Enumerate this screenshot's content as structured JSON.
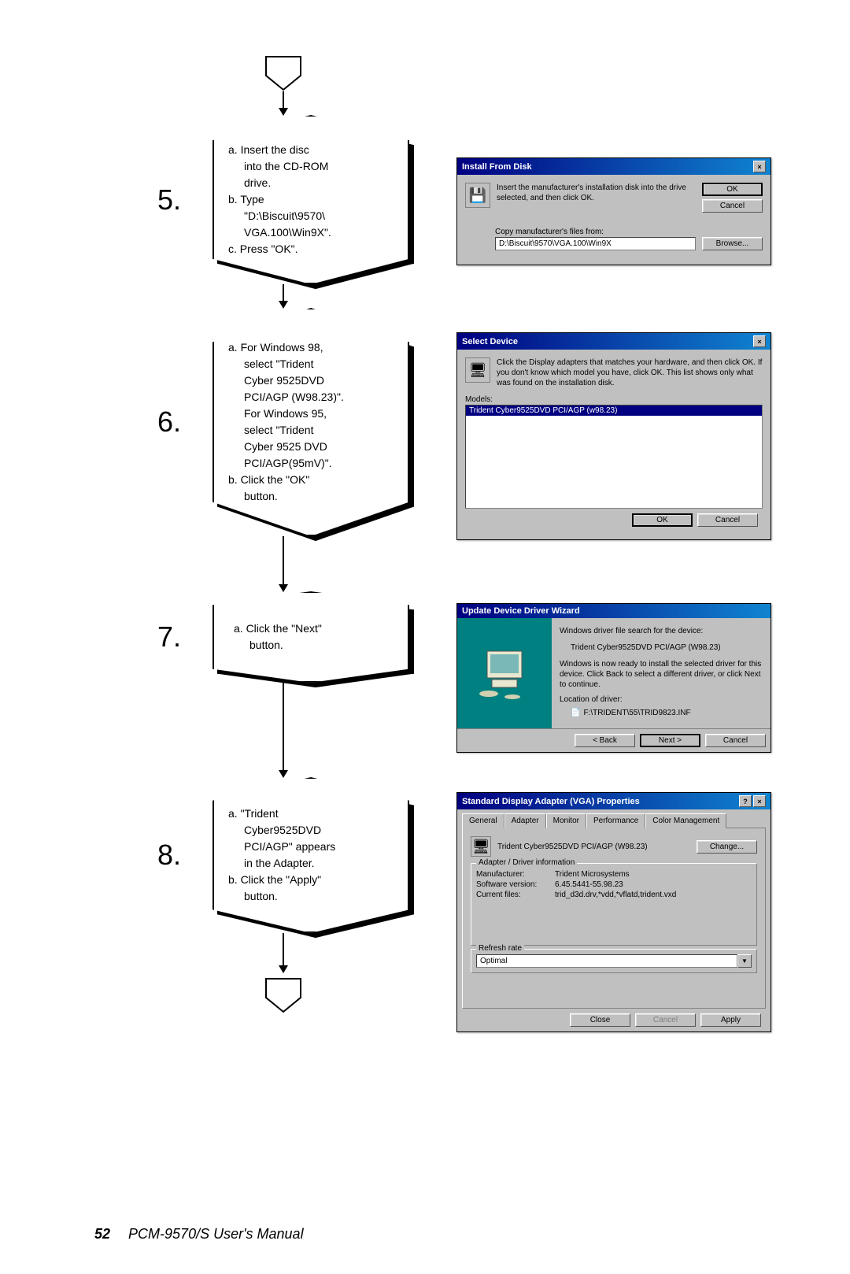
{
  "footer": {
    "page": "52",
    "title": "PCM-9570/S  User's Manual"
  },
  "steps": [
    {
      "num": "5.",
      "lines": [
        "a. Insert the disc",
        "   into the CD-ROM",
        "   drive.",
        "b. Type",
        "   \"D:\\Biscuit\\9570\\",
        "   VGA.100\\Win9X\".",
        "c. Press \"OK\"."
      ]
    },
    {
      "num": "6.",
      "lines": [
        "a. For Windows 98,",
        "   select \"Trident",
        "   Cyber 9525DVD",
        "   PCI/AGP (W98.23)\".",
        "   For Windows 95,",
        "   select \"Trident",
        "   Cyber 9525 DVD",
        "   PCI/AGP(95mV)\".",
        "b. Click the \"OK\"",
        "   button."
      ]
    },
    {
      "num": "7.",
      "lines": [
        "a. Click the \"Next\"",
        "   button."
      ]
    },
    {
      "num": "8.",
      "lines": [
        "a. \"Trident",
        "   Cyber9525DVD",
        "   PCI/AGP\" appears",
        "   in the Adapter.",
        "b. Click the \"Apply\"",
        "   button."
      ]
    }
  ],
  "dlg1": {
    "title": "Install From Disk",
    "msg": "Insert the manufacturer's installation disk into the drive selected, and then click OK.",
    "copylabel": "Copy manufacturer's files from:",
    "path": "D:\\Biscuit\\9570\\VGA.100\\Win9X",
    "ok": "OK",
    "cancel": "Cancel",
    "browse": "Browse..."
  },
  "dlg2": {
    "title": "Select Device",
    "msg": "Click the Display adapters that matches your hardware, and then click OK. If you don't know which model you have, click OK. This list shows only what was found on the installation disk.",
    "models": "Models:",
    "item": "Trident Cyber9525DVD PCI/AGP (w98.23)",
    "ok": "OK",
    "cancel": "Cancel"
  },
  "dlg3": {
    "title": "Update Device Driver Wizard",
    "l1": "Windows driver file search for the device:",
    "l2": "Trident Cyber9525DVD PCI/AGP (W98.23)",
    "l3": "Windows is now ready to install the selected driver for this device. Click Back to select a different driver, or click Next to continue.",
    "l4": "Location of driver:",
    "l5": "F:\\TRIDENT\\55\\TRID9823.INF",
    "back": "< Back",
    "next": "Next >",
    "cancel": "Cancel"
  },
  "dlg4": {
    "title": "Standard Display Adapter (VGA) Properties",
    "tabs": [
      "General",
      "Adapter",
      "Monitor",
      "Performance",
      "Color Management"
    ],
    "adapter": "Trident Cyber9525DVD PCI/AGP (W98.23)",
    "change": "Change...",
    "group1": "Adapter / Driver information",
    "mfr_k": "Manufacturer:",
    "mfr_v": "Trident Microsystems",
    "sw_k": "Software version:",
    "sw_v": "6.45.5441-55.98.23",
    "cf_k": "Current files:",
    "cf_v": "trid_d3d.drv,*vdd,*vflatd,trident.vxd",
    "group2": "Refresh rate",
    "refresh": "Optimal",
    "close": "Close",
    "cancel": "Cancel",
    "apply": "Apply"
  }
}
